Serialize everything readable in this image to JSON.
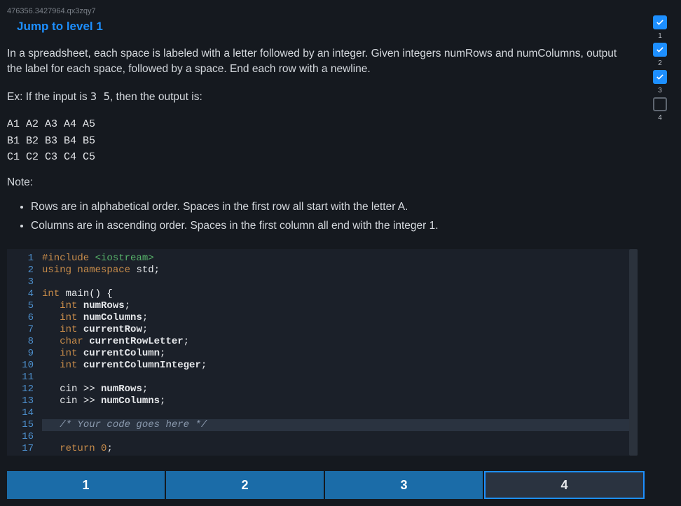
{
  "hash": "476356.3427964.qx3zqy7",
  "jump_link_label": "Jump to level 1",
  "problem": {
    "paragraph1": "In a spreadsheet, each space is labeled with a letter followed by an integer. Given integers numRows and numColumns, output the label for each space, followed by a space. End each row with a newline.",
    "example_prefix": "Ex: If the input is ",
    "example_input": "3 5",
    "example_suffix": ", then the output is:",
    "example_output": "A1 A2 A3 A4 A5\nB1 B2 B3 B4 B5\nC1 C2 C3 C4 C5",
    "note_label": "Note:",
    "notes": [
      "Rows are in alphabetical order. Spaces in the first row all start with the letter A.",
      "Columns are in ascending order. Spaces in the first column all end with the integer 1."
    ]
  },
  "code": {
    "active_line": 15,
    "lines": [
      {
        "n": 1,
        "tokens": [
          {
            "t": "#include ",
            "c": "preproc"
          },
          {
            "t": "<iostream>",
            "c": "string"
          }
        ]
      },
      {
        "n": 2,
        "tokens": [
          {
            "t": "using ",
            "c": "keyword"
          },
          {
            "t": "namespace ",
            "c": "keyword"
          },
          {
            "t": "std",
            "c": "ns"
          },
          {
            "t": ";",
            "c": "punct"
          }
        ]
      },
      {
        "n": 3,
        "tokens": []
      },
      {
        "n": 4,
        "tokens": [
          {
            "t": "int ",
            "c": "type"
          },
          {
            "t": "main",
            "c": "func"
          },
          {
            "t": "() {",
            "c": "punct"
          }
        ]
      },
      {
        "n": 5,
        "tokens": [
          {
            "t": "   ",
            "c": ""
          },
          {
            "t": "int ",
            "c": "type"
          },
          {
            "t": "numRows",
            "c": "ident"
          },
          {
            "t": ";",
            "c": "punct"
          }
        ]
      },
      {
        "n": 6,
        "tokens": [
          {
            "t": "   ",
            "c": ""
          },
          {
            "t": "int ",
            "c": "type"
          },
          {
            "t": "numColumns",
            "c": "ident"
          },
          {
            "t": ";",
            "c": "punct"
          }
        ]
      },
      {
        "n": 7,
        "tokens": [
          {
            "t": "   ",
            "c": ""
          },
          {
            "t": "int ",
            "c": "type"
          },
          {
            "t": "currentRow",
            "c": "ident"
          },
          {
            "t": ";",
            "c": "punct"
          }
        ]
      },
      {
        "n": 8,
        "tokens": [
          {
            "t": "   ",
            "c": ""
          },
          {
            "t": "char ",
            "c": "type"
          },
          {
            "t": "currentRowLetter",
            "c": "ident"
          },
          {
            "t": ";",
            "c": "punct"
          }
        ]
      },
      {
        "n": 9,
        "tokens": [
          {
            "t": "   ",
            "c": ""
          },
          {
            "t": "int ",
            "c": "type"
          },
          {
            "t": "currentColumn",
            "c": "ident"
          },
          {
            "t": ";",
            "c": "punct"
          }
        ]
      },
      {
        "n": 10,
        "tokens": [
          {
            "t": "   ",
            "c": ""
          },
          {
            "t": "int ",
            "c": "type"
          },
          {
            "t": "currentColumnInteger",
            "c": "ident"
          },
          {
            "t": ";",
            "c": "punct"
          }
        ]
      },
      {
        "n": 11,
        "tokens": []
      },
      {
        "n": 12,
        "tokens": [
          {
            "t": "   cin ",
            "c": "ns"
          },
          {
            "t": ">> ",
            "c": "punct"
          },
          {
            "t": "numRows",
            "c": "ident"
          },
          {
            "t": ";",
            "c": "punct"
          }
        ]
      },
      {
        "n": 13,
        "tokens": [
          {
            "t": "   cin ",
            "c": "ns"
          },
          {
            "t": ">> ",
            "c": "punct"
          },
          {
            "t": "numColumns",
            "c": "ident"
          },
          {
            "t": ";",
            "c": "punct"
          }
        ]
      },
      {
        "n": 14,
        "tokens": []
      },
      {
        "n": 15,
        "tokens": [
          {
            "t": "   ",
            "c": ""
          },
          {
            "t": "/* Your code goes here */",
            "c": "comment"
          }
        ]
      },
      {
        "n": 16,
        "tokens": []
      },
      {
        "n": 17,
        "tokens": [
          {
            "t": "   ",
            "c": ""
          },
          {
            "t": "return ",
            "c": "keyword"
          },
          {
            "t": "0",
            "c": "num"
          },
          {
            "t": ";",
            "c": "punct"
          }
        ]
      }
    ]
  },
  "progress_steps": [
    {
      "num": "1",
      "done": true
    },
    {
      "num": "2",
      "done": true
    },
    {
      "num": "3",
      "done": true
    },
    {
      "num": "4",
      "done": false
    }
  ],
  "bottom_tabs": [
    {
      "label": "1",
      "active": false
    },
    {
      "label": "2",
      "active": false
    },
    {
      "label": "3",
      "active": false
    },
    {
      "label": "4",
      "active": true
    }
  ]
}
